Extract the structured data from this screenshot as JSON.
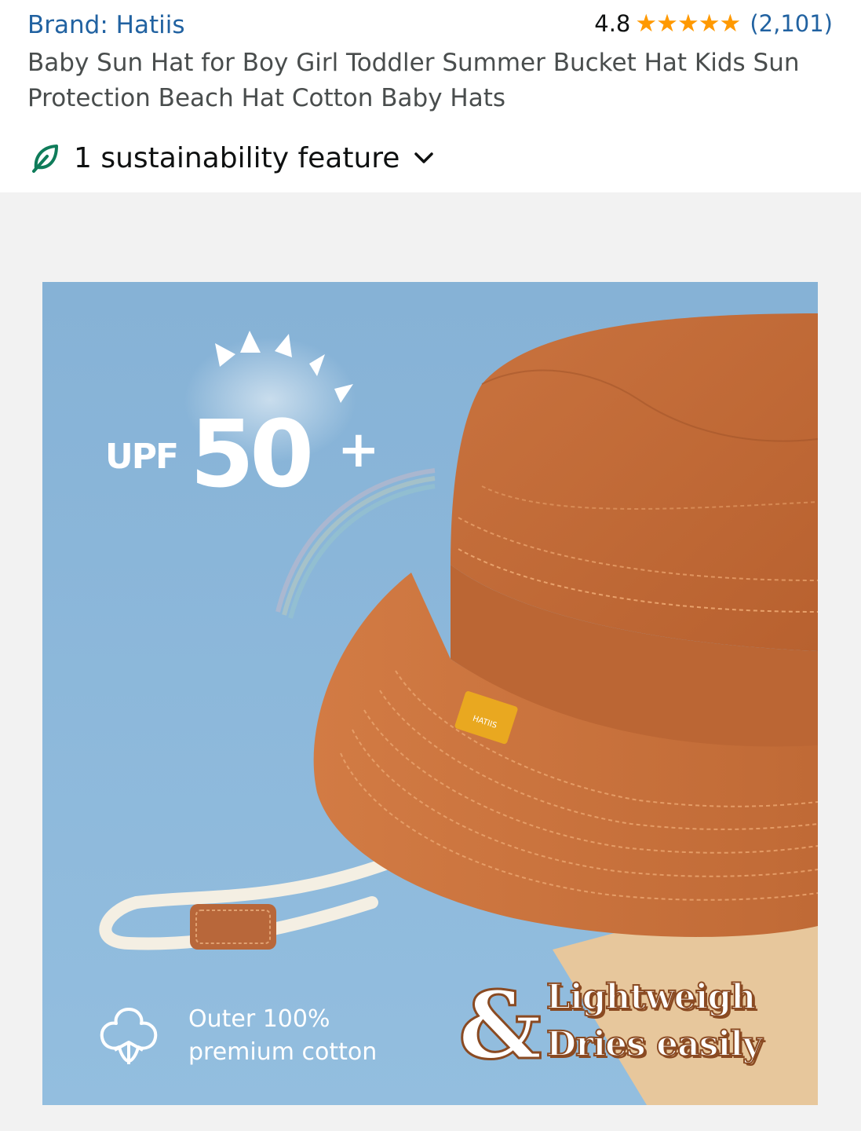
{
  "header": {
    "brand_link": "Brand: Hatiis",
    "rating_value": "4.8",
    "rating_stars": "★★★★★",
    "rating_count": "(2,101)",
    "title": "Baby Sun Hat for Boy Girl Toddler Summer Bucket Hat Kids Sun Protection Beach Hat Cotton Baby Hats",
    "sustainability_label": "1 sustainability feature"
  },
  "image": {
    "upf_label": "UPF",
    "upf_number": "50",
    "upf_plus": "+",
    "cotton_line1": "Outer 100%",
    "cotton_line2": "premium cotton",
    "feature_amp": "&",
    "feature_line1": "Lightweigh",
    "feature_line2": "Dries easily",
    "hat_tag_text": "HATIIS"
  },
  "colors": {
    "link": "#2162a1",
    "star": "#ff9900",
    "leaf": "#0f7c5a",
    "background_blue": "#8fb7d6",
    "hat_orange": "#c8703e",
    "tag_yellow": "#e9a820"
  },
  "icons": {
    "leaf": "leaf-icon",
    "chevron": "chevron-down-icon",
    "cotton": "cotton-flower-icon"
  },
  "rating_fraction": 0.96
}
